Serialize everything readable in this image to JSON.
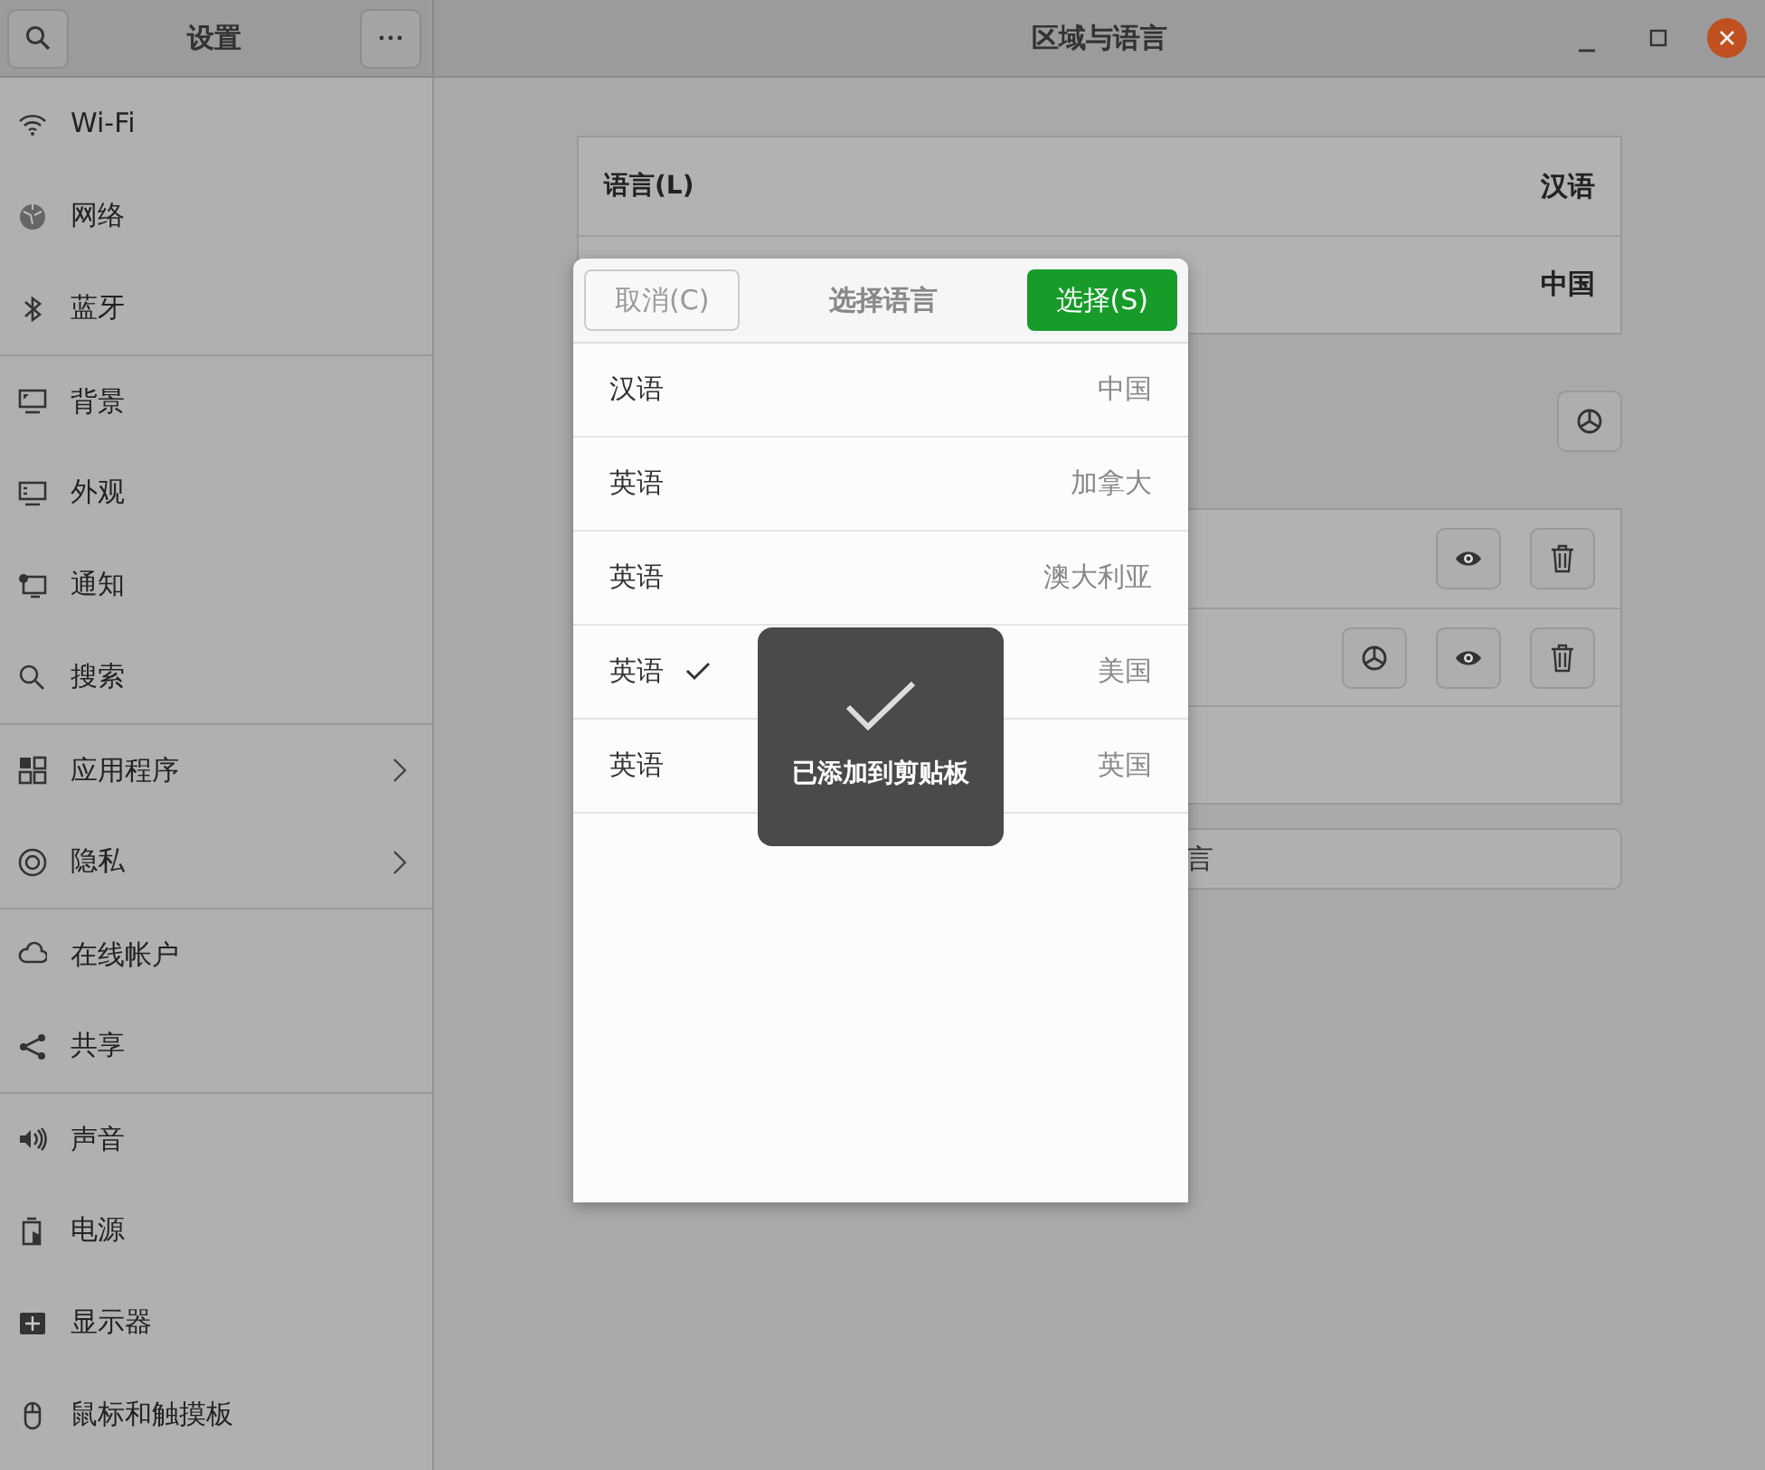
{
  "header": {
    "sidebar_title": "设置",
    "title": "区域与语言"
  },
  "sidebar": {
    "sections": [
      [
        {
          "label": "Wi-Fi",
          "submenu": false
        },
        {
          "label": "网络",
          "submenu": false
        },
        {
          "label": "蓝牙",
          "submenu": false
        }
      ],
      [
        {
          "label": "背景",
          "submenu": false
        },
        {
          "label": "外观",
          "submenu": false
        },
        {
          "label": "通知",
          "submenu": false
        },
        {
          "label": "搜索",
          "submenu": false
        }
      ],
      [
        {
          "label": "应用程序",
          "submenu": true
        },
        {
          "label": "隐私",
          "submenu": true
        }
      ],
      [
        {
          "label": "在线帐户",
          "submenu": false
        },
        {
          "label": "共享",
          "submenu": false
        }
      ],
      [
        {
          "label": "声音",
          "submenu": false
        },
        {
          "label": "电源",
          "submenu": false
        },
        {
          "label": "显示器",
          "submenu": false
        },
        {
          "label": "鼠标和触摸板",
          "submenu": false
        }
      ]
    ]
  },
  "language_panel": [
    {
      "label": "语言(L)",
      "value": "汉语"
    },
    {
      "value": "中国"
    }
  ],
  "input_sources": [
    {
      "kind": "source",
      "settings": false
    },
    {
      "kind": "source",
      "settings": true
    },
    {
      "kind": "empty"
    }
  ],
  "add_button": {
    "label": "言"
  },
  "dialog": {
    "cancel": "取消(C)",
    "title": "选择语言",
    "confirm": "选择(S)",
    "rows": [
      {
        "language": "汉语",
        "region": "中国",
        "selected": false
      },
      {
        "language": "英语",
        "region": "加拿大",
        "selected": false
      },
      {
        "language": "英语",
        "region": "澳大利亚",
        "selected": false
      },
      {
        "language": "英语",
        "region": "美国",
        "selected": true
      },
      {
        "language": "英语",
        "region": "英国",
        "selected": false
      }
    ]
  },
  "toast": {
    "message": "已添加到剪贴板"
  }
}
